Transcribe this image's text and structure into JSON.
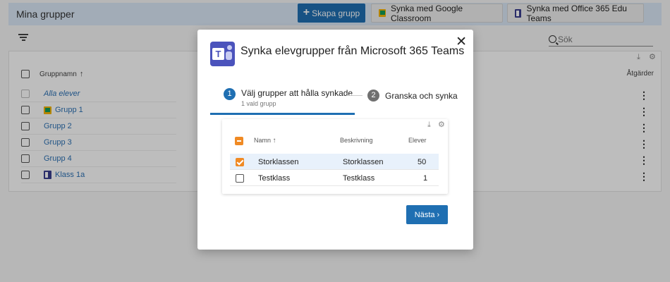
{
  "header": {
    "title": "Mina grupper",
    "create_button": "Skapa grupp",
    "google_button": "Synka med Google Classroom",
    "o365_button": "Synka med Office 365 Edu Teams"
  },
  "toolbar": {
    "search_placeholder": "Sök"
  },
  "groups_table": {
    "col_name": "Gruppnamn",
    "col_actions": "Åtgärder",
    "rows": [
      {
        "name": "Alla elever",
        "icon": null
      },
      {
        "name": "Grupp 1",
        "icon": "google-classroom-icon"
      },
      {
        "name": "Grupp 2",
        "icon": null
      },
      {
        "name": "Grupp 3",
        "icon": null
      },
      {
        "name": "Grupp 4",
        "icon": null
      },
      {
        "name": "Klass 1a",
        "icon": "office365-icon"
      }
    ]
  },
  "modal": {
    "title": "Synka elevgrupper från Microsoft 365 Teams",
    "steps": [
      {
        "number": "1",
        "label": "Välj grupper att hålla synkade",
        "sub": "1 vald grupp",
        "active": true
      },
      {
        "number": "2",
        "label": "Granska och synka",
        "active": false
      }
    ],
    "table": {
      "col_name": "Namn",
      "col_desc": "Beskrivning",
      "col_students": "Elever",
      "rows": [
        {
          "name": "Storklassen",
          "desc": "Storklassen",
          "students": "50",
          "checked": true
        },
        {
          "name": "Testklass",
          "desc": "Testklass",
          "students": "1",
          "checked": false
        }
      ]
    },
    "next_button": "Nästa"
  },
  "colors": {
    "primary": "#1f6fb2",
    "checkbox_accent": "#f08a24",
    "header_bg": "#dbe9f7",
    "teams_brand": "#4b53bc"
  }
}
